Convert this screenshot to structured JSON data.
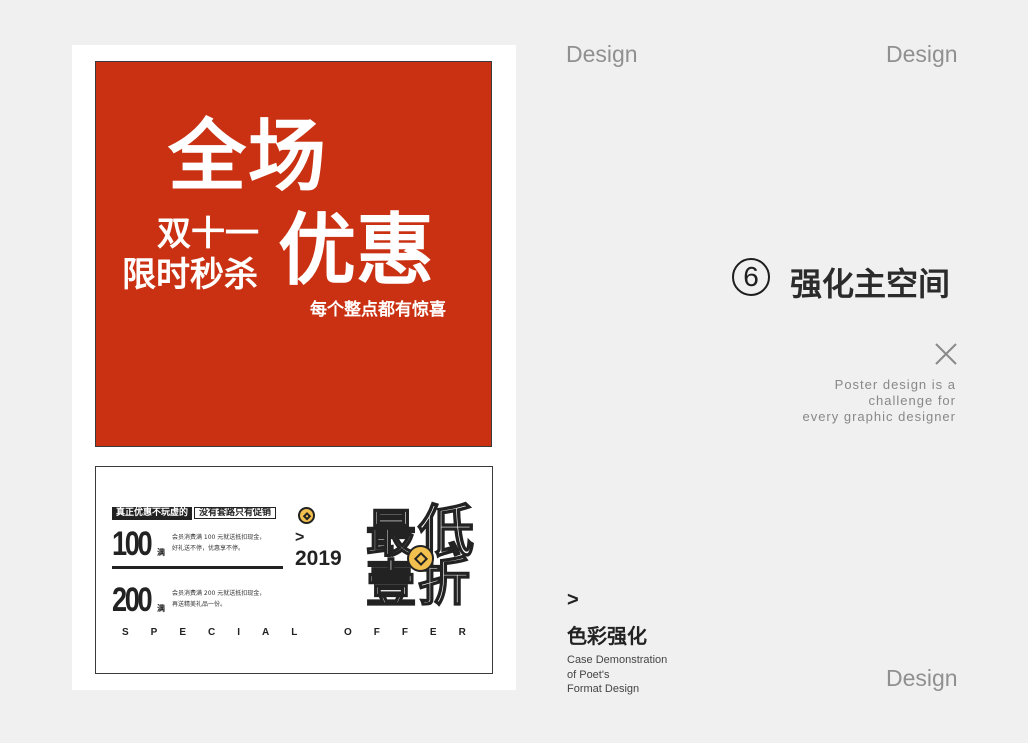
{
  "poster_top": {
    "headline_1": "全场",
    "side_line_1": "双十一",
    "side_line_2": "限时秒杀",
    "headline_2": "优惠",
    "subline": "每个整点都有惊喜",
    "bg_color": "#c93112"
  },
  "poster_bottom": {
    "tag_1": "真正优惠不玩虚的",
    "tag_2": "没有套路只有促销",
    "amount_1": "100",
    "unit_1": "满",
    "desc_1_line1": "会员消费满 100 元就送抵扣现金，",
    "desc_1_line2": "好礼送不停，优惠享不停。",
    "amount_2": "200",
    "unit_2": "满",
    "desc_2_line1": "会员消费满 200 元就送抵扣现金，",
    "desc_2_line2": "再送精美礼品一份。",
    "arrow": ">",
    "year": "2019",
    "big_char_1": "最",
    "big_char_2": "低",
    "big_char_3": "壹",
    "big_char_4": "折",
    "special_offer": "SPECIAL OFFER",
    "badge_color": "#f2c04e"
  },
  "right_panel": {
    "design_top_left": "Design",
    "design_top_right": "Design",
    "design_bottom_right": "Design",
    "step_number": "6",
    "section_title": "强化主空间",
    "tagline_line1": "Poster design is a",
    "tagline_line2": "challenge for",
    "tagline_line3": "every graphic designer",
    "arrow": ">",
    "subsection_title": "色彩强化",
    "case_line1": "Case Demonstration",
    "case_line2": "of Poet's",
    "case_line3": "Format Design"
  }
}
